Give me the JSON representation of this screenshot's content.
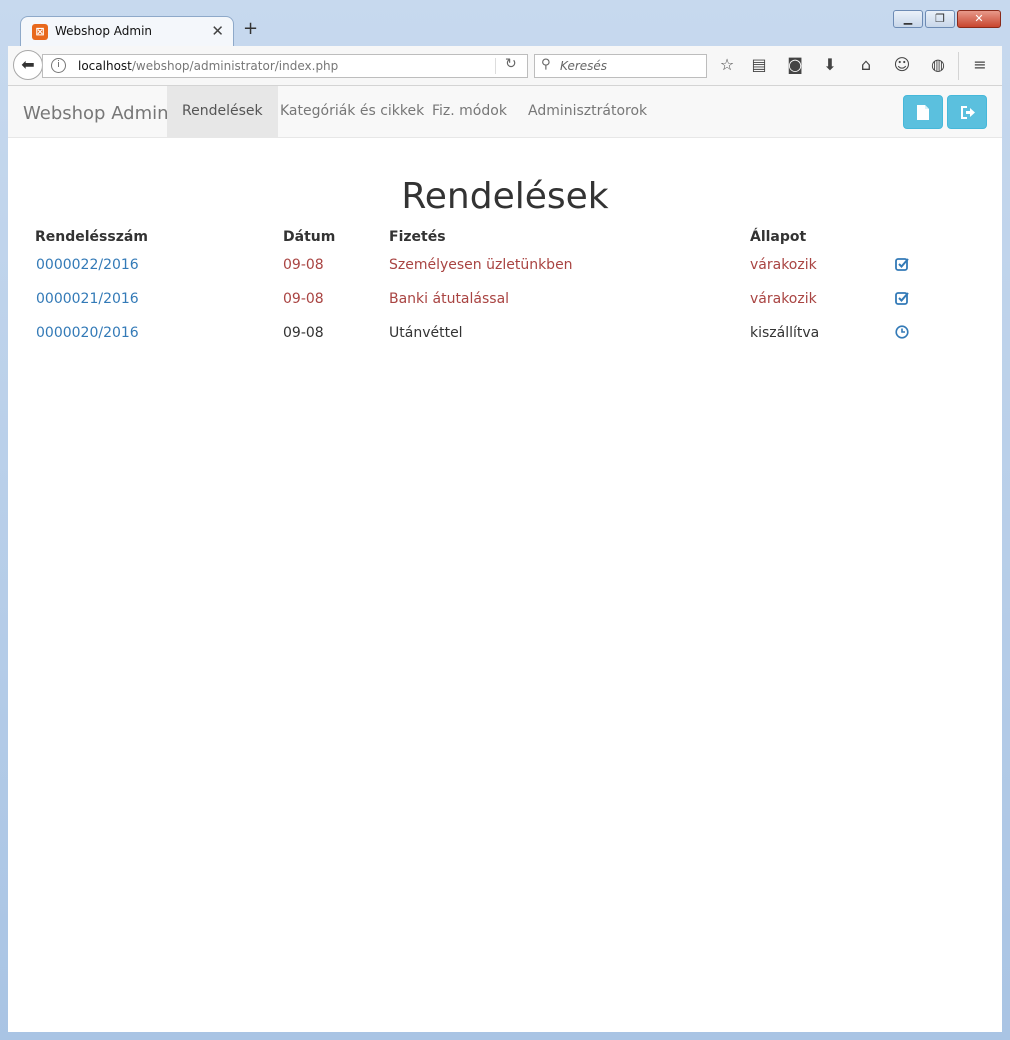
{
  "browser": {
    "tab_title": "Webshop Admin",
    "url_host": "localhost",
    "url_path": "/webshop/administrator/index.php",
    "search_placeholder": "Keresés"
  },
  "navbar": {
    "brand": "Webshop Admin",
    "items": [
      {
        "label": "Rendelések",
        "active": true
      },
      {
        "label": "Kategóriák és cikkek",
        "active": false
      },
      {
        "label": "Fiz. módok",
        "active": false
      },
      {
        "label": "Adminisztrátorok",
        "active": false
      }
    ],
    "buttons": [
      "document-icon",
      "logout-icon"
    ]
  },
  "page": {
    "title": "Rendelések",
    "columns": [
      "Rendelésszám",
      "Dátum",
      "Fizetés",
      "Állapot"
    ],
    "rows": [
      {
        "number": "0000022/2016",
        "date": "09-08",
        "payment": "Személyesen üzletünkben",
        "status": "várakozik",
        "action_icon": "check-square-icon",
        "highlight": "danger"
      },
      {
        "number": "0000021/2016",
        "date": "09-08",
        "payment": "Banki átutalással",
        "status": "várakozik",
        "action_icon": "check-square-icon",
        "highlight": "danger"
      },
      {
        "number": "0000020/2016",
        "date": "09-08",
        "payment": "Utánvéttel",
        "status": "kiszállítva",
        "action_icon": "clock-icon",
        "highlight": "none"
      }
    ]
  },
  "colors": {
    "link": "#337ab7",
    "danger": "#a94442",
    "info_button": "#5bc0de"
  }
}
